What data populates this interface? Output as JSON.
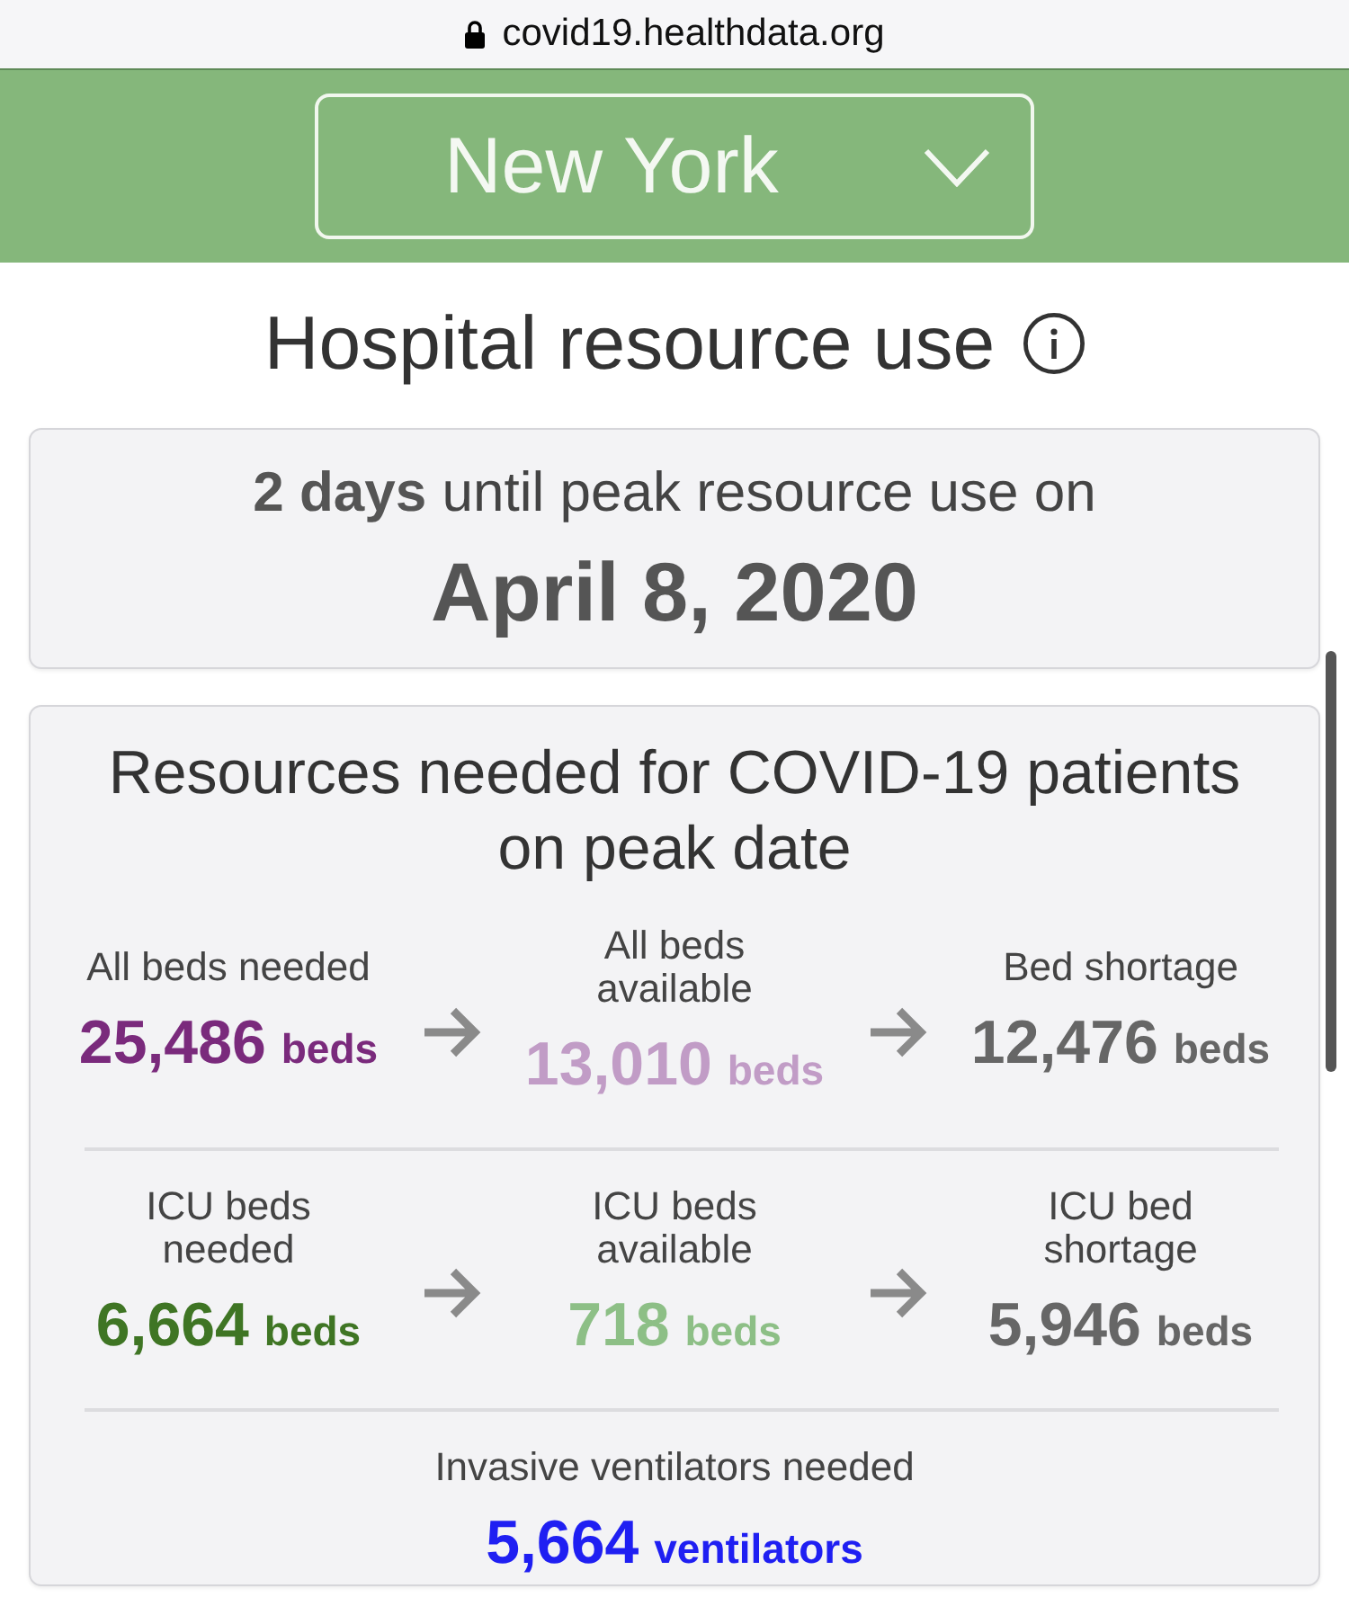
{
  "address_bar": {
    "url": "covid19.healthdata.org"
  },
  "location_selector": {
    "value": "New York"
  },
  "section": {
    "title": "Hospital resource use"
  },
  "peak_card": {
    "text": "**2 days** until peak resource use on",
    "date": "April 8, 2020"
  },
  "resources_card": {
    "title": "Resources needed for COVID-19 patients on peak date",
    "rows": [
      {
        "stats": [
          {
            "label": "All beds needed",
            "value": "25,486",
            "unit": "beds",
            "color": "#7a2a7c"
          },
          {
            "label": "All beds\navailable",
            "value": "13,010",
            "unit": "beds",
            "color": "#c19cc6"
          },
          {
            "label": "Bed shortage",
            "value": "12,476",
            "unit": "beds",
            "color": "#666666"
          }
        ]
      },
      {
        "stats": [
          {
            "label": "ICU beds\nneeded",
            "value": "6,664",
            "unit": "beds",
            "color": "#3f7524"
          },
          {
            "label": "ICU beds\navailable",
            "value": "718",
            "unit": "beds",
            "color": "#8dbf86"
          },
          {
            "label": "ICU bed\nshortage",
            "value": "5,946",
            "unit": "beds",
            "color": "#666666"
          }
        ]
      },
      {
        "stats": [
          {
            "label": "Invasive ventilators needed",
            "value": "5,664",
            "unit": "ventilators",
            "color": "#1f1ff2"
          }
        ]
      }
    ]
  }
}
